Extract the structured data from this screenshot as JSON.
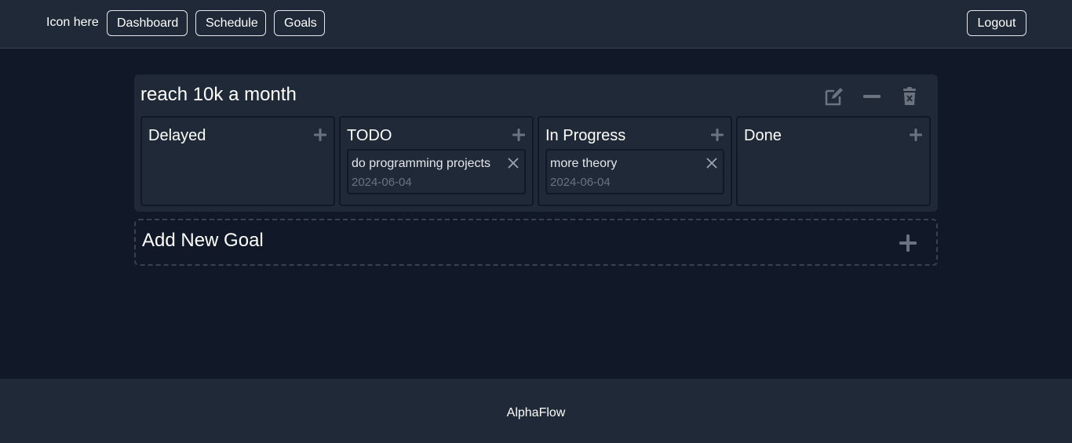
{
  "header": {
    "brand": "Icon here",
    "nav": {
      "dashboard": "Dashboard",
      "schedule": "Schedule",
      "goals": "Goals"
    },
    "logout": "Logout"
  },
  "goal": {
    "title": "reach 10k a month",
    "actions": [
      "edit-icon",
      "minus-icon",
      "trash-icon"
    ],
    "columns": [
      {
        "title": "Delayed",
        "tasks": []
      },
      {
        "title": "TODO",
        "tasks": [
          {
            "name": "do programming projects",
            "date": "2024-06-04"
          }
        ]
      },
      {
        "title": "In Progress",
        "tasks": [
          {
            "name": "more theory",
            "date": "2024-06-04"
          }
        ]
      },
      {
        "title": "Done",
        "tasks": []
      }
    ]
  },
  "add_goal": {
    "label": "Add New Goal"
  },
  "footer": {
    "text": "AlphaFlow"
  },
  "colors": {
    "background": "#111827",
    "surface": "#1f2937",
    "border": "#374151",
    "muted_icon": "#6b7280"
  }
}
